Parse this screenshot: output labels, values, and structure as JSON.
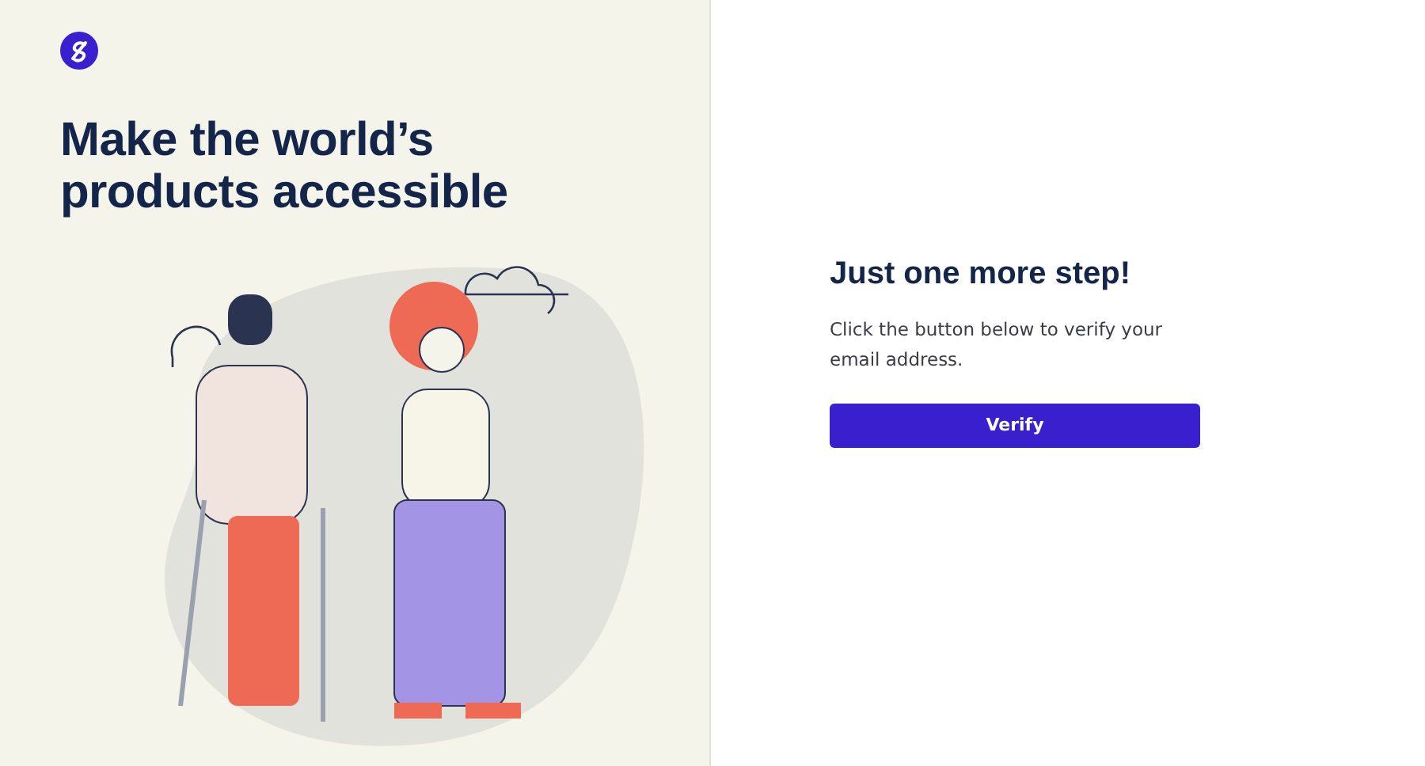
{
  "hero": {
    "headline": "Make the world’s products accessible"
  },
  "card": {
    "title": "Just one more step!",
    "message": "Click the button below to verify your email address.",
    "button": "Verify"
  }
}
